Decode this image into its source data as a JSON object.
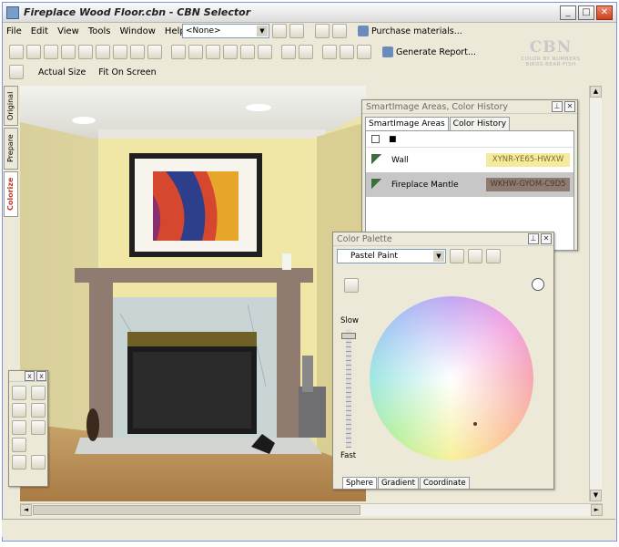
{
  "window": {
    "title": "Fireplace Wood Floor.cbn - CBN Selector",
    "controls": {
      "minimize": "_",
      "maximize": "□",
      "close": "✕"
    }
  },
  "menu": [
    "File",
    "Edit",
    "View",
    "Tools",
    "Window",
    "Help"
  ],
  "toolbar": {
    "combo_value": "<None>",
    "purchase_label": "Purchase materials...",
    "report_label": "Generate Report...",
    "actual_size_label": "Actual Size",
    "fit_label": "Fit On Screen"
  },
  "brand": {
    "name": "CBN",
    "line1": "COLOR BY NUMBERS",
    "line2": "BIRDS·BEAR·FISH"
  },
  "left_tabs": [
    "Original",
    "Prepare",
    "Colorize"
  ],
  "smartimage_panel": {
    "title": "SmartImage Areas, Color History",
    "tabs": [
      "SmartImage Areas",
      "Color History"
    ],
    "areas": [
      {
        "name": "Wall",
        "code": "XYNR-YE65-HWXW",
        "color": "#f6ea9f"
      },
      {
        "name": "Fireplace Mantle",
        "code": "WKHW-GYOM-C9D5",
        "color": "#8e7a6e"
      }
    ]
  },
  "color_palette": {
    "title": "Color Palette",
    "palette_select": "Pastel Paint",
    "slider_top": "Slow",
    "slider_bottom": "Fast",
    "tabs": [
      "Sphere",
      "Gradient",
      "Coordinate"
    ]
  },
  "tool_palette": {
    "controls": {
      "pin": "x",
      "close": "x"
    }
  }
}
